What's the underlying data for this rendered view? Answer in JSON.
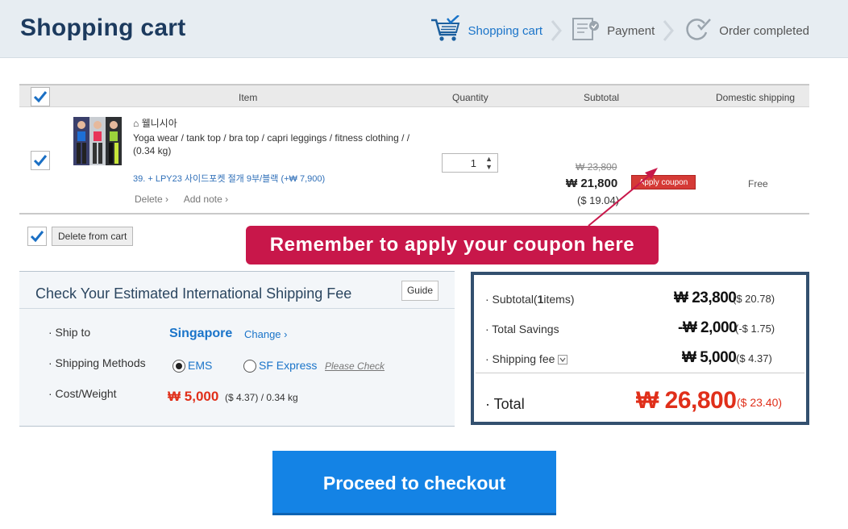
{
  "header": {
    "title": "Shopping cart",
    "steps": [
      {
        "label": "Shopping cart",
        "icon": "cart-icon",
        "active": true
      },
      {
        "label": "Payment",
        "icon": "payment-doc-icon",
        "active": false
      },
      {
        "label": "Order completed",
        "icon": "order-complete-icon",
        "active": false
      }
    ]
  },
  "table": {
    "headers": {
      "item": "Item",
      "quantity": "Quantity",
      "subtotal": "Subtotal",
      "shipping": "Domestic shipping"
    },
    "rows": [
      {
        "shop_name": "웰니시아",
        "title": "Yoga wear / tank top / bra top / capri leggings / fitness clothing /  / (0.34 kg)",
        "option": "39. + LPY23 사이드포켓 절개 9부/블랙 (+₩ 7,900)",
        "delete_label": "Delete ›",
        "add_note_label": "Add note ›",
        "quantity": "1",
        "old_price": "₩ 23,800",
        "new_price": "₩ 21,800",
        "usd_price": "($ 19.04)",
        "coupon_label": "Apply coupon",
        "shipping": "Free",
        "checked": true
      }
    ]
  },
  "delete_from_cart_label": "Delete from cart",
  "callout": "Remember to apply your coupon here",
  "shipping_estimate": {
    "title": "Check Your Estimated International Shipping Fee",
    "guide_label": "Guide",
    "ship_to_label": "· Ship to",
    "country": "Singapore",
    "change_label": "Change ›",
    "methods_label": "· Shipping Methods",
    "method_ems": "EMS",
    "method_sf": "SF Express",
    "please_check": "Please Check",
    "selected_method": "EMS",
    "cost_label": "· Cost/Weight",
    "cost_value": "₩ 5,000",
    "cost_rest": "($ 4.37) /  0.34 kg"
  },
  "summary": {
    "subtotal_label": "· Subtotal(",
    "subtotal_count": "1",
    "subtotal_label_end": "items)",
    "subtotal_value": "₩ 23,800",
    "subtotal_usd": "($ 20.78)",
    "savings_label": "· Total Savings",
    "savings_value": "-₩ 2,000",
    "savings_usd": "(-$ 1.75)",
    "shipping_label": "· Shipping fee",
    "shipping_value": "₩ 5,000",
    "shipping_usd": "($ 4.37)",
    "total_label": "· Total",
    "total_value": "₩ 26,800",
    "total_usd": "($ 23.40)"
  },
  "checkout_label": "Proceed to checkout",
  "colors": {
    "accent_blue": "#1a74c9",
    "checkout_blue": "#1483e5",
    "callout_red": "#c8174a",
    "price_red": "#e02f1a",
    "summary_border": "#33506f"
  }
}
